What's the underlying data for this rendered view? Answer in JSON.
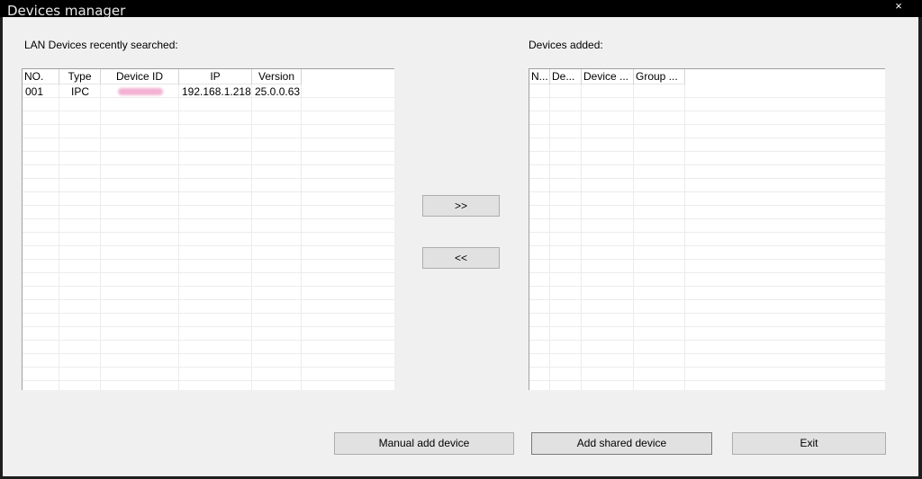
{
  "window": {
    "title": "Devices manager",
    "close_glyph": "×"
  },
  "left_panel": {
    "label": "LAN Devices recently searched:",
    "columns": [
      "NO.",
      "Type",
      "Device ID",
      "IP",
      "Version"
    ],
    "rows": [
      {
        "no": "001",
        "type": "IPC",
        "ip": "192.168.1.218",
        "version": "25.0.0.63"
      }
    ]
  },
  "right_panel": {
    "label": "Devices added:",
    "columns": [
      "N...",
      "De...",
      "Device ...",
      "Group ..."
    ]
  },
  "transfer": {
    "add": ">>",
    "remove": "<<"
  },
  "buttons": {
    "manual_add": "Manual add device",
    "add_shared": "Add shared device",
    "exit": "Exit"
  }
}
